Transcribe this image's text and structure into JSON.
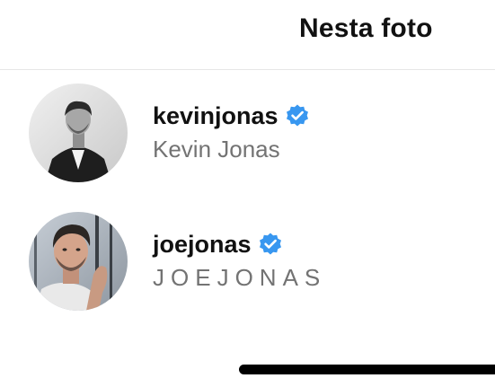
{
  "header": {
    "title": "Nesta foto"
  },
  "tagged_people": [
    {
      "username": "kevinjonas",
      "full_name": "Kevin Jonas",
      "verified": true,
      "avatar_icon": "kevinjonas-avatar"
    },
    {
      "username": "joejonas",
      "full_name": "JOEJONAS",
      "verified": true,
      "avatar_icon": "joejonas-avatar"
    }
  ],
  "colors": {
    "verified_blue": "#3897f0",
    "secondary_text": "#737373",
    "primary_text": "#111111",
    "divider": "#e6e6e6"
  }
}
